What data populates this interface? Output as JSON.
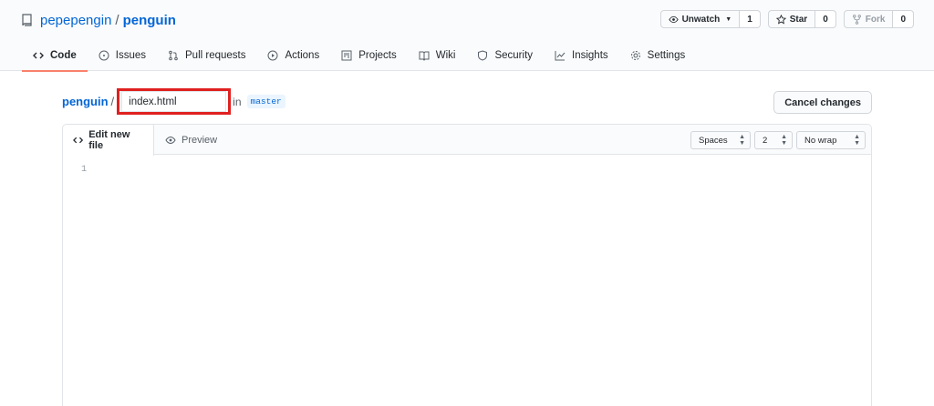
{
  "repo": {
    "owner": "pepepengin",
    "separator": "/",
    "name": "penguin"
  },
  "actions": [
    {
      "label": "Unwatch",
      "count": "1"
    },
    {
      "label": "Star",
      "count": "0"
    },
    {
      "label": "Fork",
      "count": "0"
    }
  ],
  "tabs": [
    "Code",
    "Issues",
    "Pull requests",
    "Actions",
    "Projects",
    "Wiki",
    "Security",
    "Insights",
    "Settings"
  ],
  "path": {
    "repo": "penguin",
    "separator": "/",
    "filename_value": "index.html",
    "in_text": "in",
    "branch": "master"
  },
  "cancel_label": "Cancel changes",
  "editor": {
    "tab_edit": "Edit new file",
    "tab_preview": "Preview",
    "indent_mode": "Spaces",
    "indent_size": "2",
    "wrap_mode": "No wrap",
    "line_number": "1"
  },
  "colors": {
    "accent": "#0366d6",
    "tab_underline": "#f9826c",
    "highlight_box": "#e02020"
  }
}
